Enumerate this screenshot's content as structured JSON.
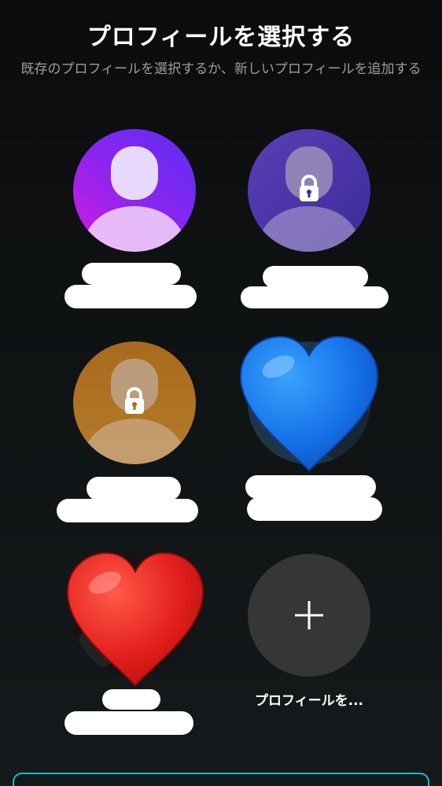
{
  "header": {
    "title": "プロフィールを選択する",
    "subtitle": "既存のプロフィールを選択するか、新しいプロフィールを追加する"
  },
  "profiles": [
    {
      "id": "p1",
      "style": "purple",
      "locked": false
    },
    {
      "id": "p2",
      "style": "indigo",
      "locked": true
    },
    {
      "id": "p3",
      "style": "amber",
      "locked": true
    },
    {
      "id": "p4",
      "style": "photo",
      "locked": false,
      "cover": "blue-heart"
    },
    {
      "id": "p5",
      "style": "photo",
      "locked": false,
      "cover": "red-heart"
    }
  ],
  "add_profile": {
    "label": "プロフィールを..."
  },
  "colors": {
    "accent": "#1fb8c9",
    "background": "#0f1213",
    "subtitle": "#9a9ea1",
    "add_circle": "#343638"
  }
}
